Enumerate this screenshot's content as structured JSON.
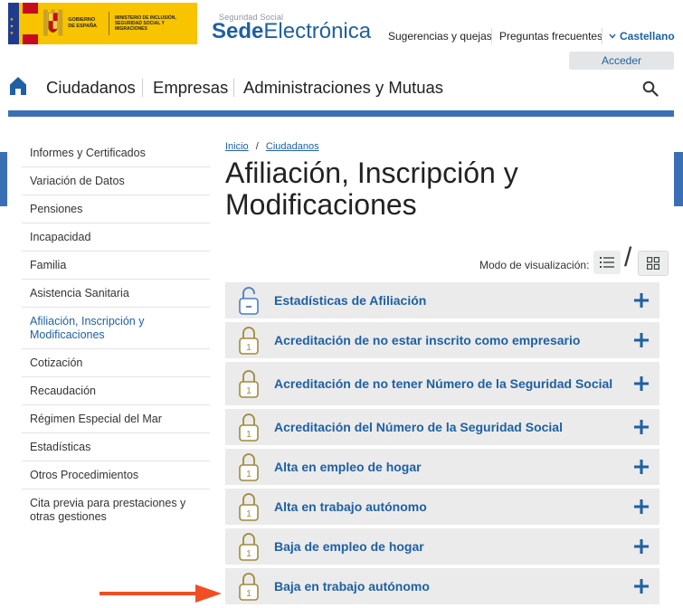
{
  "header": {
    "gov_logo": {
      "gobierno_text": "GOBIERNO DE ESPAÑA",
      "ministry_text": "MINISTERIO DE INCLUSIÓN, SEGURIDAD SOCIAL Y MIGRACIONES"
    },
    "sede_small": "Seguridad Social",
    "sede_bold": "Sede",
    "sede_light": "Electrónica",
    "links": {
      "sugerencias": "Sugerencias y quejas",
      "preguntas": "Preguntas frecuentes",
      "language": "Castellano"
    },
    "login_label": "Acceder"
  },
  "nav": {
    "items": [
      "Ciudadanos",
      "Empresas",
      "Administraciones y Mutuas"
    ]
  },
  "sidebar": {
    "items": [
      "Informes y Certificados",
      "Variación de Datos",
      "Pensiones",
      "Incapacidad",
      "Familia",
      "Asistencia Sanitaria",
      "Afiliación, Inscripción y Modificaciones",
      "Cotización",
      "Recaudación",
      "Régimen Especial del Mar",
      "Estadísticas",
      "Otros Procedimientos",
      "Cita previa para prestaciones y otras gestiones"
    ],
    "active": "Afiliación, Inscripción y Modificaciones"
  },
  "breadcrumb": {
    "home": "Inicio",
    "separator": "/",
    "current": "Ciudadanos"
  },
  "page_title": "Afiliación, Inscripción y Modificaciones",
  "view_mode": {
    "label": "Modo de visualización:",
    "separator": "/"
  },
  "procedures": [
    {
      "label": "Estadísticas de Afiliación",
      "lock": "open"
    },
    {
      "label": "Acreditación de no estar inscrito como empresario",
      "lock": "level-1"
    },
    {
      "label": "Acreditación de no tener Número de la Seguridad Social",
      "lock": "level-1"
    },
    {
      "label": "Acreditación del Número de la Seguridad Social",
      "lock": "level-1"
    },
    {
      "label": "Alta en empleo de hogar",
      "lock": "level-1"
    },
    {
      "label": "Alta en trabajo autónomo",
      "lock": "level-1"
    },
    {
      "label": "Baja de empleo de hogar",
      "lock": "level-1"
    },
    {
      "label": "Baja en trabajo autónomo",
      "lock": "level-1"
    }
  ],
  "colors": {
    "brand_blue": "#1e60a3",
    "bar_blue": "#3a6fb5",
    "lock_gold": "#a08a3c",
    "open_lock_blue": "#4b7fc0",
    "annotation_arrow": "#f04e23"
  }
}
